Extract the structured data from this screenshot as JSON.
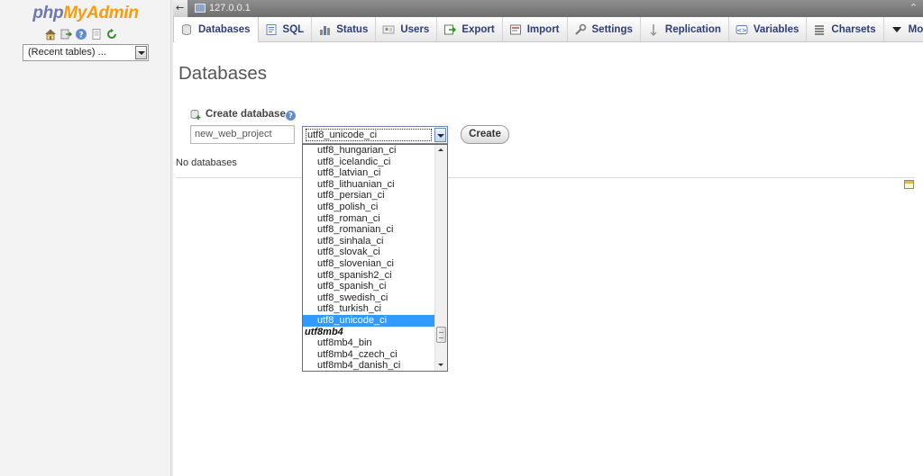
{
  "sidebar": {
    "logo_php": "php",
    "logo_myadmin": "MyAdmin",
    "icons": [
      "home-icon",
      "logout-icon",
      "help-icon",
      "docs-icon",
      "reload-icon"
    ],
    "recent_tables": "(Recent tables) ..."
  },
  "serverbar": {
    "collapse": "←",
    "server_name": "127.0.0.1",
    "toggle": "⌃"
  },
  "tabs": [
    {
      "label": "Databases",
      "icon": "database-icon",
      "active": true
    },
    {
      "label": "SQL",
      "icon": "sql-icon"
    },
    {
      "label": "Status",
      "icon": "status-icon"
    },
    {
      "label": "Users",
      "icon": "users-icon"
    },
    {
      "label": "Export",
      "icon": "export-icon"
    },
    {
      "label": "Import",
      "icon": "import-icon"
    },
    {
      "label": "Settings",
      "icon": "settings-icon"
    },
    {
      "label": "Replication",
      "icon": "replication-icon"
    },
    {
      "label": "Variables",
      "icon": "variables-icon"
    },
    {
      "label": "Charsets",
      "icon": "charsets-icon"
    },
    {
      "label": "More",
      "icon": "chevron-down-icon"
    }
  ],
  "main": {
    "title": "Databases",
    "create_label": "Create database",
    "db_name_value": "new_web_project",
    "collation_value": "utf8_unicode_ci",
    "create_button": "Create",
    "no_databases": "No databases"
  },
  "dropdown": {
    "items": [
      {
        "type": "option",
        "label": "utf8_hungarian_ci"
      },
      {
        "type": "option",
        "label": "utf8_icelandic_ci"
      },
      {
        "type": "option",
        "label": "utf8_latvian_ci"
      },
      {
        "type": "option",
        "label": "utf8_lithuanian_ci"
      },
      {
        "type": "option",
        "label": "utf8_persian_ci"
      },
      {
        "type": "option",
        "label": "utf8_polish_ci"
      },
      {
        "type": "option",
        "label": "utf8_roman_ci"
      },
      {
        "type": "option",
        "label": "utf8_romanian_ci"
      },
      {
        "type": "option",
        "label": "utf8_sinhala_ci"
      },
      {
        "type": "option",
        "label": "utf8_slovak_ci"
      },
      {
        "type": "option",
        "label": "utf8_slovenian_ci"
      },
      {
        "type": "option",
        "label": "utf8_spanish2_ci"
      },
      {
        "type": "option",
        "label": "utf8_spanish_ci"
      },
      {
        "type": "option",
        "label": "utf8_swedish_ci"
      },
      {
        "type": "option",
        "label": "utf8_turkish_ci"
      },
      {
        "type": "option",
        "label": "utf8_unicode_ci",
        "selected": true
      },
      {
        "type": "group",
        "label": "utf8mb4"
      },
      {
        "type": "option",
        "label": "utf8mb4_bin"
      },
      {
        "type": "option",
        "label": "utf8mb4_czech_ci"
      },
      {
        "type": "option",
        "label": "utf8mb4_danish_ci"
      }
    ]
  },
  "colors": {
    "tab_text": "#2b3e77",
    "selection": "#3399ff",
    "logo_php": "#6c78af",
    "logo_myadmin": "#f89c0e"
  }
}
